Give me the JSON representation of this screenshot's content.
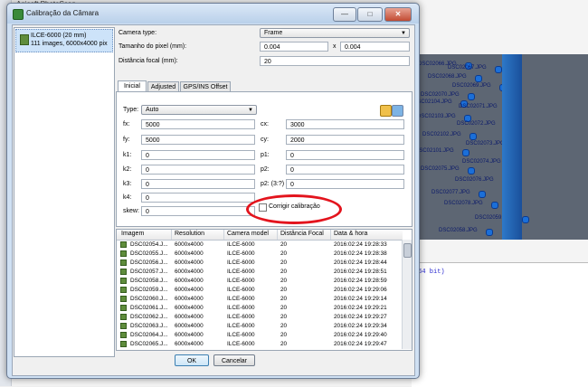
{
  "background": {
    "app_title": "Agisoft PhotoScan",
    "photo_labels": [
      "DSC02066.JPG",
      "DSC02067.JPG",
      "DSC02068.JPG",
      "DSC02069.JPG",
      "DSC02070.JPG",
      "DSC02104.JPG",
      "DSC02071.JPG",
      "DSC02103.JPG",
      "DSC02072.JPG",
      "DSC02102.JPG",
      "DSC02073.JPG",
      "DSC02101.JPG",
      "DSC02074.JPG",
      "DSC02075.JPG",
      "DSC02076.JPG",
      "DSC02077.JPG",
      "DSC02078.JPG",
      "DSC02059.JPG",
      "DSC02058.JPG"
    ],
    "console_text": "(64 bit)"
  },
  "dialog": {
    "title": "Calibração da Câmara",
    "minimize": "—",
    "maximize": "□",
    "close": "✕"
  },
  "camera_list": {
    "items": [
      {
        "name": "ILCE-6000 (20 mm)",
        "info": "111 images, 6000x4000 pix"
      }
    ]
  },
  "settings": {
    "camera_type_label": "Camera type:",
    "camera_type_value": "Frame",
    "pixel_size_label": "Tamanho do pixel (mm):",
    "pixel_size_x": "0.004",
    "pixel_size_sep": "x",
    "pixel_size_y": "0.004",
    "focal_label": "Distância focal (mm):",
    "focal_value": "20"
  },
  "tabs": [
    {
      "label": "Inicial"
    },
    {
      "label": "Adjusted"
    },
    {
      "label": "GPS/INS Offset"
    }
  ],
  "inicial": {
    "type_label": "Type:",
    "type_value": "Auto",
    "fx_label": "fx:",
    "fx_value": "5000",
    "fy_label": "fy:",
    "fy_value": "5000",
    "k1_label": "k1:",
    "k1_value": "0",
    "k2_label": "k2:",
    "k2_value": "0",
    "k3_label": "k3:",
    "k3_value": "0",
    "k4_label": "k4:",
    "k4_value": "0",
    "skew_label": "skew:",
    "skew_value": "0",
    "cx_label": "cx:",
    "cx_value": "3000",
    "cy_label": "cy:",
    "cy_value": "2000",
    "p1_label": "p1:",
    "p1_value": "0",
    "p2_label": "p2:",
    "p2_value": "0",
    "p2b_label": "p2: (3:?)",
    "p2b_value": "0",
    "fix_label": "Corrigir calibração",
    "fix_checked": false
  },
  "table": {
    "columns": [
      "Imagem",
      "Resolution",
      "Camera model",
      "Distância Focal",
      "Data & hora"
    ],
    "rows": [
      [
        "DSC02054.J...",
        "6000x4000",
        "ILCE-6000",
        "20",
        "2016:02:24 19:28:33"
      ],
      [
        "DSC02055.J...",
        "6000x4000",
        "ILCE-6000",
        "20",
        "2016:02:24 19:28:38"
      ],
      [
        "DSC02056.J...",
        "6000x4000",
        "ILCE-6000",
        "20",
        "2016:02:24 19:28:44"
      ],
      [
        "DSC02057.J...",
        "6000x4000",
        "ILCE-6000",
        "20",
        "2016:02:24 19:28:51"
      ],
      [
        "DSC02058.J...",
        "6000x4000",
        "ILCE-6000",
        "20",
        "2016:02:24 19:28:59"
      ],
      [
        "DSC02059.J...",
        "6000x4000",
        "ILCE-6000",
        "20",
        "2016:02:24 19:29:06"
      ],
      [
        "DSC02060.J...",
        "6000x4000",
        "ILCE-6000",
        "20",
        "2016:02:24 19:29:14"
      ],
      [
        "DSC02061.J...",
        "6000x4000",
        "ILCE-6000",
        "20",
        "2016:02:24 19:29:21"
      ],
      [
        "DSC02062.J...",
        "6000x4000",
        "ILCE-6000",
        "20",
        "2016:02:24 19:29:27"
      ],
      [
        "DSC02063.J...",
        "6000x4000",
        "ILCE-6000",
        "20",
        "2016:02:24 19:29:34"
      ],
      [
        "DSC02064.J...",
        "6000x4000",
        "ILCE-6000",
        "20",
        "2016:02:24 19:29:40"
      ],
      [
        "DSC02065.J...",
        "6000x4000",
        "ILCE-6000",
        "20",
        "2016:02:24 19:29:47"
      ]
    ]
  },
  "buttons": {
    "ok": "OK",
    "cancel": "Cancelar"
  },
  "colors": {
    "highlight_ellipse": "#e3141d",
    "selection": "#cde3f9"
  }
}
